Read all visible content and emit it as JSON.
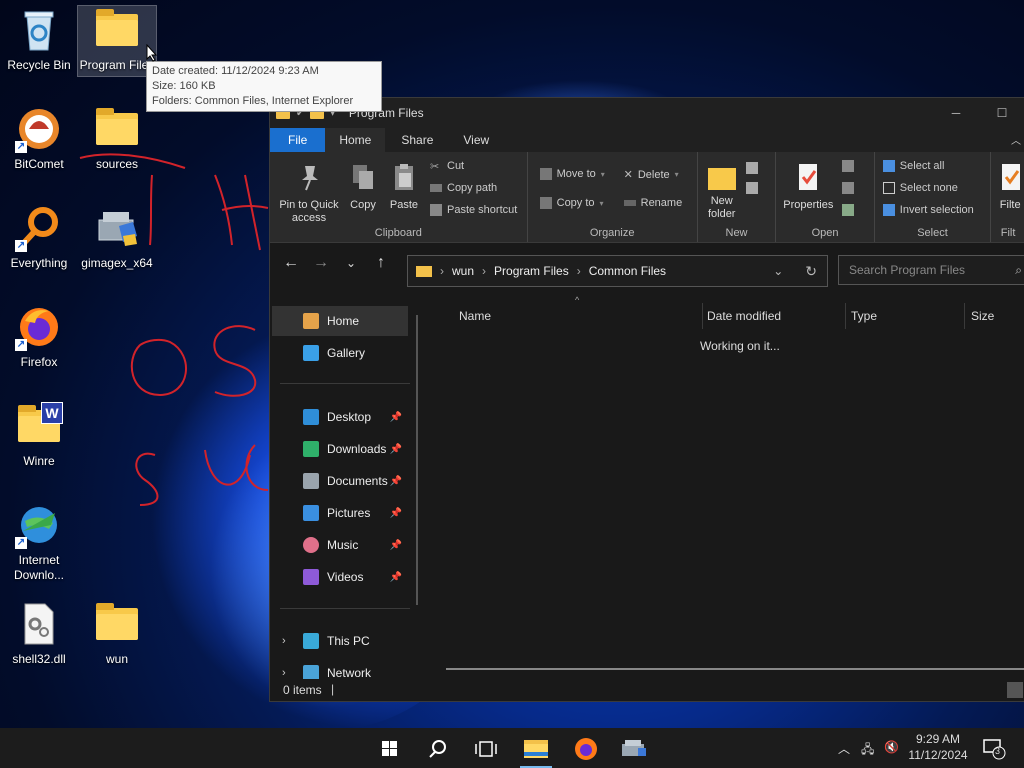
{
  "desktop": {
    "icons": [
      {
        "label": "Recycle Bin"
      },
      {
        "label": "Program Files"
      },
      {
        "label": "BitComet"
      },
      {
        "label": "sources"
      },
      {
        "label": "Everything"
      },
      {
        "label": "gimagex_x64"
      },
      {
        "label": "Firefox"
      },
      {
        "label": "Winre"
      },
      {
        "label": "Internet Downlo..."
      },
      {
        "label": "shell32.dll"
      },
      {
        "label": "wun"
      }
    ],
    "tooltip": {
      "line1": "Date created: 11/12/2024 9:23 AM",
      "line2": "Size: 160 KB",
      "line3": "Folders: Common Files, Internet Explorer"
    }
  },
  "explorer": {
    "title": "Program Files",
    "tabs": [
      "File",
      "Home",
      "Share",
      "View"
    ],
    "ribbon": {
      "clipboard": {
        "name": "Clipboard",
        "pin": "Pin to Quick access",
        "copy": "Copy",
        "paste": "Paste",
        "cut": "Cut",
        "copy_path": "Copy path",
        "paste_shortcut": "Paste shortcut"
      },
      "organize": {
        "name": "Organize",
        "move_to": "Move to",
        "copy_to": "Copy to",
        "delete": "Delete",
        "rename": "Rename"
      },
      "new": {
        "name": "New",
        "new_folder": "New folder"
      },
      "open": {
        "name": "Open",
        "properties": "Properties"
      },
      "select": {
        "name": "Select",
        "select_all": "Select all",
        "select_none": "Select none",
        "invert": "Invert selection"
      },
      "filter": {
        "name": "Filt",
        "label": "Filte"
      }
    },
    "address": {
      "crumbs": [
        "wun",
        "Program Files",
        "Common Files"
      ]
    },
    "search_placeholder": "Search Program Files",
    "nav": {
      "home": "Home",
      "gallery": "Gallery",
      "quick": [
        "Desktop",
        "Downloads",
        "Documents",
        "Pictures",
        "Music",
        "Videos"
      ],
      "this_pc": "This PC",
      "network": "Network"
    },
    "columns": [
      "Name",
      "Date modified",
      "Type",
      "Size"
    ],
    "loading": "Working on it...",
    "status": "0 items"
  },
  "taskbar": {
    "time": "9:29 AM",
    "date": "11/12/2024",
    "notifications": "3"
  }
}
